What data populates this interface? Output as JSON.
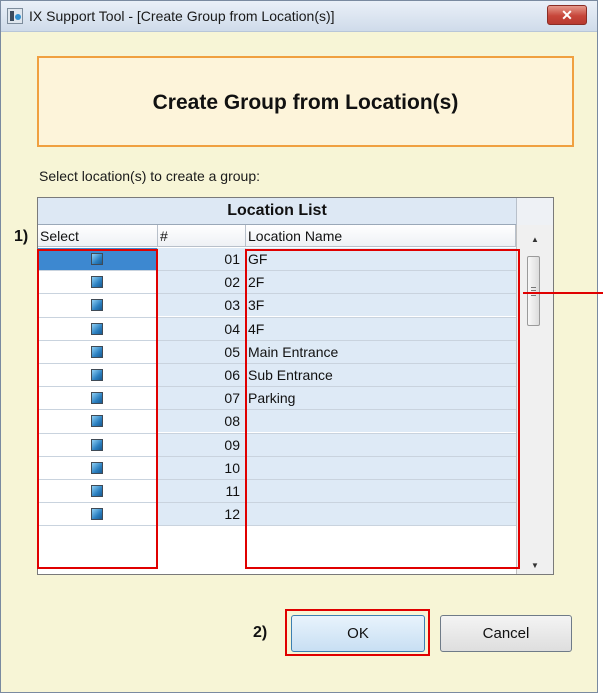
{
  "window": {
    "title": "IX Support Tool - [Create Group from Location(s)]",
    "close_label": "✕"
  },
  "header": {
    "title": "Create Group from Location(s)"
  },
  "instruction": "Select location(s) to create a group:",
  "table": {
    "title": "Location List",
    "columns": [
      "Select",
      "#",
      "Location Name"
    ],
    "rows": [
      {
        "num": "01",
        "name": "GF"
      },
      {
        "num": "02",
        "name": "2F"
      },
      {
        "num": "03",
        "name": "3F"
      },
      {
        "num": "04",
        "name": "4F"
      },
      {
        "num": "05",
        "name": "Main Entrance"
      },
      {
        "num": "06",
        "name": "Sub Entrance"
      },
      {
        "num": "07",
        "name": "Parking"
      },
      {
        "num": "08",
        "name": ""
      },
      {
        "num": "09",
        "name": ""
      },
      {
        "num": "10",
        "name": ""
      },
      {
        "num": "11",
        "name": ""
      },
      {
        "num": "12",
        "name": ""
      }
    ]
  },
  "annotations": {
    "a1": "1)",
    "a2": "2)"
  },
  "buttons": {
    "ok": "OK",
    "cancel": "Cancel"
  },
  "colors": {
    "highlight": "#e00000",
    "header_border": "#f0a040",
    "selected_cell": "#3d88d0"
  }
}
